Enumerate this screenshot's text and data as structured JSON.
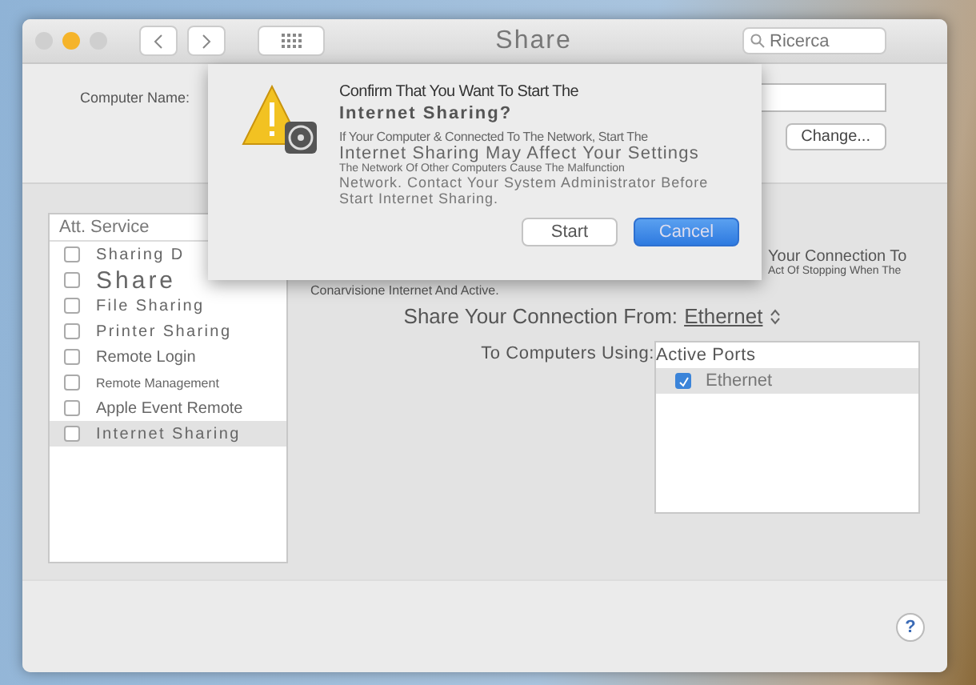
{
  "window": {
    "title": "Share",
    "search_placeholder": "Ricerca"
  },
  "computer_name": {
    "label": "Computer Name:",
    "change_button": "Change..."
  },
  "services": {
    "header": "Att. Service",
    "items": [
      {
        "label": "Sharing D",
        "checked": false,
        "selected": false,
        "kind": "wide"
      },
      {
        "label": "Share",
        "checked": false,
        "selected": false,
        "kind": "big"
      },
      {
        "label": "File Sharing",
        "checked": false,
        "selected": false,
        "kind": "wide"
      },
      {
        "label": "Printer Sharing",
        "checked": false,
        "selected": false,
        "kind": "wide"
      },
      {
        "label": "Remote Login",
        "checked": false,
        "selected": false,
        "kind": "narrow"
      },
      {
        "label": "Remote Management",
        "checked": false,
        "selected": false,
        "kind": "tiny"
      },
      {
        "label": "Apple Event Remote",
        "checked": false,
        "selected": false,
        "kind": "narrow"
      },
      {
        "label": "Internet Sharing",
        "checked": false,
        "selected": true,
        "kind": "wide"
      }
    ]
  },
  "notes": [
    "Your Connection To",
    "Act Of Stopping When The"
  ],
  "status": "Conarvisione Internet And Active.",
  "share_from": {
    "label": "Share Your Connection From:",
    "value": "Ethernet"
  },
  "to_computers": {
    "label": "To Computers Using:",
    "header": "Active Ports",
    "ports": [
      {
        "label": "Ethernet",
        "checked": true,
        "selected": true
      }
    ]
  },
  "dialog": {
    "title": "Confirm That You Want To Start The",
    "subtitle": "Internet Sharing?",
    "lines": [
      {
        "text": "If Your Computer & Connected To The Network, Start The",
        "kind": "narrow"
      },
      {
        "text": "Internet Sharing May Affect Your Settings",
        "kind": "large"
      },
      {
        "text": "The Network Of Other Computers Cause The Malfunction",
        "kind": "small"
      },
      {
        "text": "Network. Contact Your System Administrator Before",
        "kind": "wide"
      },
      {
        "text": "Start Internet Sharing.",
        "kind": "wide"
      }
    ],
    "buttons": [
      {
        "label": "Start",
        "default": false
      },
      {
        "label": "Cancel",
        "default": true
      }
    ]
  },
  "help": "?"
}
